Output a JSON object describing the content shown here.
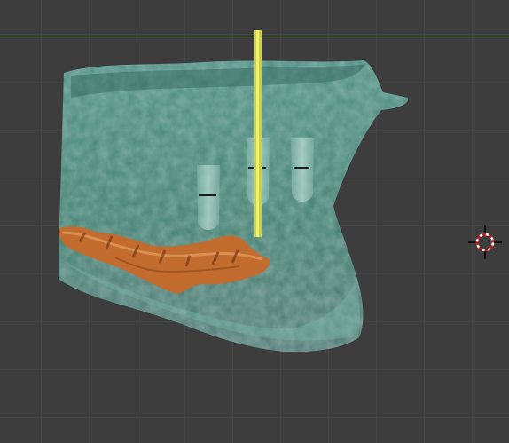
{
  "viewport": {
    "background_color": "#3d3d3d",
    "grid_color": "#444444",
    "horizon_color": "#5f8a2e"
  },
  "scene": {
    "objects": [
      {
        "name": "jaw-bone-mesh",
        "color": "#4f9a8a",
        "transparent": true
      },
      {
        "name": "nerve-canal-mesh",
        "color": "#c06a30"
      },
      {
        "name": "implant-guide-pin",
        "color": "#d4d43a"
      },
      {
        "name": "dental-implant-left",
        "color": "#9fc8bc"
      },
      {
        "name": "dental-implant-middle",
        "color": "#9fc8bc"
      },
      {
        "name": "dental-implant-right",
        "color": "#9fc8bc"
      }
    ]
  },
  "icons": {
    "cursor_3d": "3d-cursor-icon"
  }
}
